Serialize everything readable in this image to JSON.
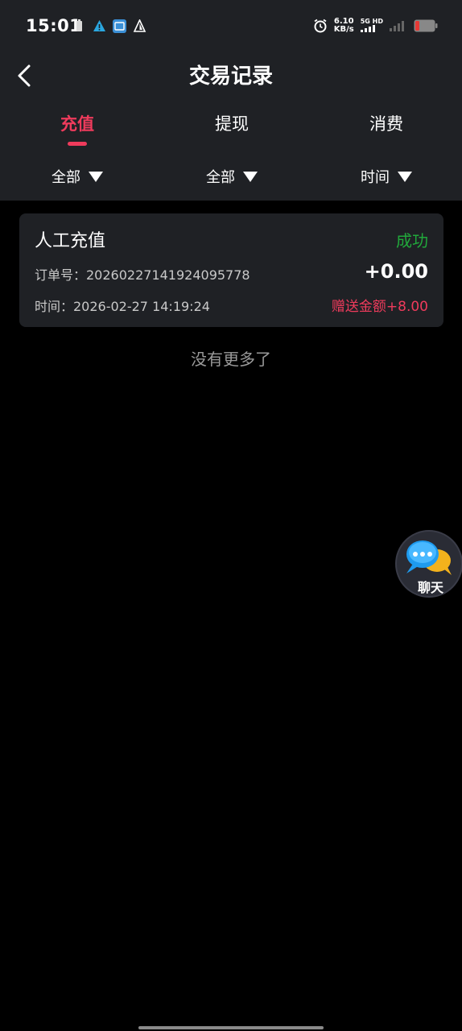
{
  "status_bar": {
    "time": "15:01",
    "net_speed_value": "6.10",
    "net_speed_unit": "KB/s",
    "network_type": "5G HD",
    "left_icons": [
      "battery-saver-icon",
      "warning-icon",
      "app-notification-icon",
      "alert-triangle-icon"
    ],
    "right_icons": [
      "alarm-icon",
      "signal-icon",
      "battery-icon"
    ]
  },
  "header": {
    "title": "交易记录",
    "back_icon": "chevron-left-icon"
  },
  "tabs": [
    {
      "label": "充值",
      "active": true
    },
    {
      "label": "提现",
      "active": false
    },
    {
      "label": "消费",
      "active": false
    }
  ],
  "filters": [
    {
      "label": "全部"
    },
    {
      "label": "全部"
    },
    {
      "label": "时间"
    }
  ],
  "records": [
    {
      "title": "人工充值",
      "status": "成功",
      "order_label": "订单号：20260227141924095778",
      "amount": "+0.00",
      "time_label": "时间：2026-02-27 14:19:24",
      "bonus": "赠送金额+8.00"
    }
  ],
  "list_footer": "没有更多了",
  "chat_button": {
    "label": "聊天",
    "icon": "chat-bubbles-icon"
  },
  "colors": {
    "accent": "#ef3b5c",
    "success": "#21a83b",
    "panel": "#1f2125",
    "background": "#000000"
  }
}
